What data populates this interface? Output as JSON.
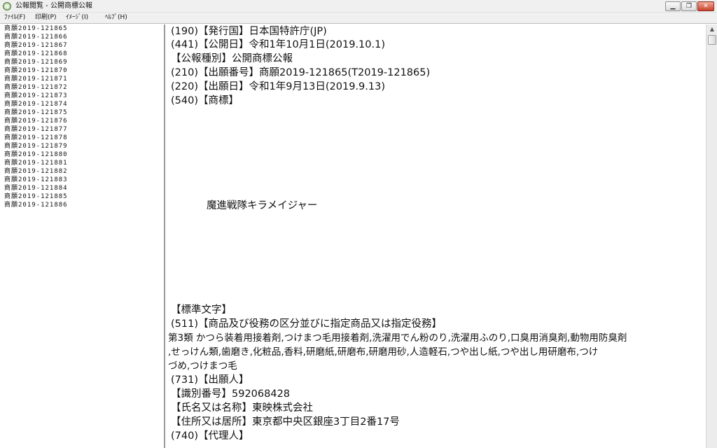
{
  "window": {
    "title": "公報閲覧 - 公開商標公報",
    "controls": {
      "minimize": "▁",
      "maximize": "❐",
      "close": "✕"
    }
  },
  "menu": [
    {
      "label": "ﾌｧｲﾙ(F)"
    },
    {
      "label": "印刷(P)"
    },
    {
      "label": "ｲﾒｰｼﾞ(I)"
    },
    {
      "label": "ﾍﾙﾌﾟ(H)"
    }
  ],
  "sidebar": {
    "items": [
      "商願2019-121865",
      "商願2019-121866",
      "商願2019-121867",
      "商願2019-121868",
      "商願2019-121869",
      "商願2019-121870",
      "商願2019-121871",
      "商願2019-121872",
      "商願2019-121873",
      "商願2019-121874",
      "商願2019-121875",
      "商願2019-121876",
      "商願2019-121877",
      "商願2019-121878",
      "商願2019-121879",
      "商願2019-121880",
      "商願2019-121881",
      "商願2019-121882",
      "商願2019-121883",
      "商願2019-121884",
      "商願2019-121885",
      "商願2019-121886"
    ]
  },
  "document": {
    "issuer": "(190)【発行国】日本国特許庁(JP)",
    "publication_date": "(441)【公開日】令和1年10月1日(2019.10.1)",
    "publication_type": "【公報種別】公開商標公報",
    "application_number": "(210)【出願番号】商願2019-121865(T2019-121865)",
    "filing_date": "(220)【出願日】令和1年9月13日(2019.9.13)",
    "trademark_heading": "(540)【商標】",
    "trademark_text": "魔進戦隊キラメイジャー",
    "standard_characters": "【標準文字】",
    "goods_heading": "(511)【商品及び役務の区分並びに指定商品又は指定役務】",
    "goods_line1": "第3類 かつら装着用接着剤,つけまつ毛用接着剤,洗濯用でん粉のり,洗濯用ふのり,口臭用消臭剤,動物用防臭剤",
    "goods_line2": ",せっけん類,歯磨き,化粧品,香料,研磨紙,研磨布,研磨用砂,人造軽石,つや出し紙,つや出し用研磨布,つけ",
    "goods_line3": "づめ,つけまつ毛",
    "applicant_heading": "(731)【出願人】",
    "applicant_id": "【識別番号】592068428",
    "applicant_name": "【氏名又は名称】東映株式会社",
    "applicant_address": "【住所又は居所】東京都中央区銀座3丁目2番17号",
    "agent_heading": "(740)【代理人】"
  },
  "scrollbar": {
    "up_arrow": "▲"
  }
}
